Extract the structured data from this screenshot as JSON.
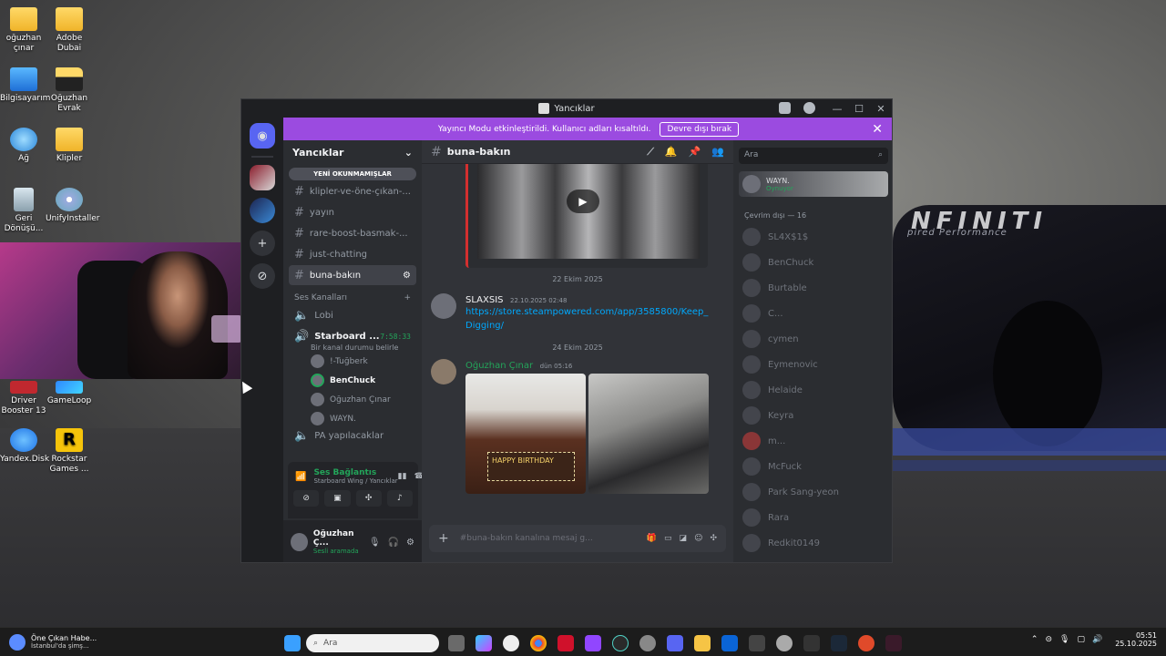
{
  "desktop": {
    "icons": [
      {
        "label": "oğuzhan çınar",
        "type": "folder"
      },
      {
        "label": "Adobe Dubai",
        "type": "folder"
      },
      {
        "label": "Bilgisayarım",
        "type": "computer"
      },
      {
        "label": "Oğuzhan Evrak",
        "type": "folder-dark"
      },
      {
        "label": "Ağ",
        "type": "network"
      },
      {
        "label": "Klipler",
        "type": "folder"
      },
      {
        "label": "Geri Dönüşü...",
        "type": "recycle"
      },
      {
        "label": "UnifyInstaller",
        "type": "disc"
      },
      {
        "label": "Driver Booster 13",
        "type": "app"
      },
      {
        "label": "GameLoop",
        "type": "app"
      },
      {
        "label": "Yandex.Disk",
        "type": "app"
      },
      {
        "label": "Rockstar Games ...",
        "type": "app"
      }
    ],
    "wallpaper_text": "NFINITI",
    "wallpaper_sub": "pired Performance"
  },
  "window": {
    "title": "Yancıklar",
    "banner": {
      "text": "Yayıncı Modu etkinleştirildi. Kullanıcı adları kısaltıldı.",
      "button": "Devre dışı bırak"
    },
    "server_name": "Yancıklar",
    "new_unreads": "YENİ OKUNMAMIŞLAR",
    "channels": [
      {
        "name": "klipler-ve-öne-çıkan-...",
        "active": false
      },
      {
        "name": "yayın",
        "active": false
      },
      {
        "name": "rare-boost-basmak-...",
        "active": false
      },
      {
        "name": "just-chatting",
        "active": false
      },
      {
        "name": "buna-bakın",
        "active": true
      }
    ],
    "voice_category": "Ses Kanalları",
    "voice_channels": [
      {
        "name": "Lobi"
      },
      {
        "name": "Starboard ...",
        "timer": "7:58:33",
        "status": "Bir kanal durumu belirle"
      }
    ],
    "voice_users": [
      {
        "name": "!-Tuğberk",
        "bold": false
      },
      {
        "name": "BenChuck",
        "bold": true
      },
      {
        "name": "Oğuzhan Çınar",
        "bold": false
      },
      {
        "name": "WAYN.",
        "bold": false
      }
    ],
    "next_channel": "PA yapılacaklar",
    "voice_connection": {
      "status": "Ses Bağlantısı Kurulc",
      "location": "Starboard Wing / Yancıklar"
    },
    "user": {
      "name": "Oğuzhan Ç...",
      "status": "Sesli aramada"
    },
    "chat": {
      "channel": "buna-bakın",
      "date1": "22 Ekim 2025",
      "msg1": {
        "author": "SLAXSIS",
        "time": "22.10.2025 02:48",
        "link": "https://store.steampowered.com/app/3585800/Keep_Digging/"
      },
      "date2": "24 Ekim 2025",
      "msg2": {
        "author": "Oğuzhan Çınar",
        "time": "dün 05:16"
      },
      "cake_text": "HAPPY BIRTHDAY",
      "input_placeholder": "#buna-bakın kanalına mesaj g..."
    },
    "members": {
      "search_placeholder": "Ara",
      "top_member": {
        "name": "WAYN.",
        "activity": "Oynuyor"
      },
      "offline_header": "Çevrim dışı — 16",
      "offline": [
        "SL4X$1$",
        "BenChuck",
        "Burtable",
        "C...",
        "cymen",
        "Eymenovic",
        "Helaide",
        "Keyra",
        "m...",
        "McFuck",
        "Park Sang-yeon",
        "Rara",
        "Redkit0149"
      ]
    }
  },
  "taskbar": {
    "news_title": "Öne Çıkan Habe...",
    "news_sub": "İstanbul'da şimş...",
    "search_placeholder": "Ara",
    "time": "05:51",
    "date": "25.10.2025"
  },
  "colors": {
    "discord_bg": "#313338",
    "sidebar": "#2b2d31",
    "rail": "#1e1f22",
    "banner": "#9b4be0",
    "link": "#00a8fc",
    "green": "#23a55a"
  }
}
